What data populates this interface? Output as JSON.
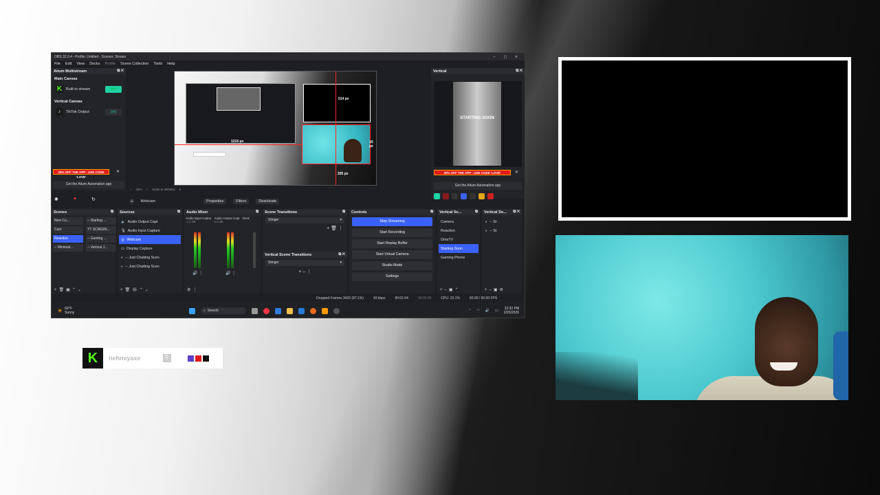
{
  "obs": {
    "title": "OBS 32.0.4 - Profile: Untitled - Scenes: Stream",
    "menu": [
      "File",
      "Edit",
      "View",
      "Docks",
      "Profile",
      "Scene Collection",
      "Tools",
      "Help"
    ],
    "aitum": {
      "title": "Aitum Multistream",
      "main_canvas": "Main Canvas",
      "built_in_stream": "Built-in stream",
      "vertical_canvas": "Vertical Canvas",
      "tiktok_output": "TikTok Output",
      "promo": "30% OFF THE APP - USE CODE 'LOVE'",
      "promo_button": "Get the Aitum Automation app"
    },
    "preview": {
      "label_514": "514 px",
      "label_1215": "1215 px",
      "label_205": "205 px",
      "label_right": "19 px",
      "zoom": "42%",
      "scale_to_window": "Scale to Window"
    },
    "vertical": {
      "title": "Vertical",
      "starting_text": "STARTING SOON",
      "promo": "30% OFF THE APP - USE CODE 'LOVE'",
      "promo_button": "Get the Aitum Automation app"
    },
    "source_bar": {
      "source": "Webcam",
      "properties": "Properties",
      "filters": "Filters",
      "deactivate": "Deactivate"
    },
    "scenes": {
      "title": "Scenes",
      "items": [
        "New Co...",
        "-- Starting ...",
        "Cam",
        "YT SCREEN...",
        "Reaction",
        "-- Gaming ...",
        "-- Minimali...",
        "-- Vertical J..."
      ]
    },
    "sources": {
      "title": "Sources",
      "items": [
        "Audio Output Capt",
        "Audio Input Capture",
        "Webcam",
        "Display Capture",
        "-- Just Chatting Scen",
        "-- Just Chatting Scen"
      ]
    },
    "mixer": {
      "title": "Audio Mixer",
      "ch1": "Audio Input Captur",
      "ch1_db": "-1.1 dB",
      "ch2": "Audio Output Capt",
      "ch2_db": "0.0 dB",
      "ch3": "Desk"
    },
    "transitions": {
      "title": "Scene Transitions",
      "value": "Stinger",
      "vertical_title": "Vertical Scene Transitions",
      "vertical_value": "Stinger"
    },
    "controls": {
      "title": "Controls",
      "buttons": [
        "Stop Streaming",
        "Start Recording",
        "Start Replay Buffer",
        "Start Virtual Camera",
        "Studio Mode",
        "Settings"
      ]
    },
    "vscenes": {
      "title": "Vertical Sc...",
      "items": [
        "Camera",
        "Reaction",
        "OmeTV",
        "Starting Soon",
        "Gaming Phone"
      ]
    },
    "vsources": {
      "title": "Vertical So...",
      "items": [
        "-- St",
        "-- St"
      ]
    },
    "status": {
      "dropped": "Dropped Frames 3420 (87.1%)",
      "bitrate": "43 kbps",
      "live": "00:01:04",
      "rec": "00:00:00",
      "cpu": "CPU: 23.1%",
      "fps": "60.00 / 60.00 FPS"
    },
    "taskbar": {
      "weather_temp": "69°F",
      "weather_desc": "Sunny",
      "search": "Search",
      "time": "12:32 PM",
      "date": "2/25/2026"
    }
  },
  "badge": {
    "name": "nehmiyaxe",
    "colors": [
      "#5b3fc4",
      "#e01a1a",
      "#111111"
    ]
  }
}
